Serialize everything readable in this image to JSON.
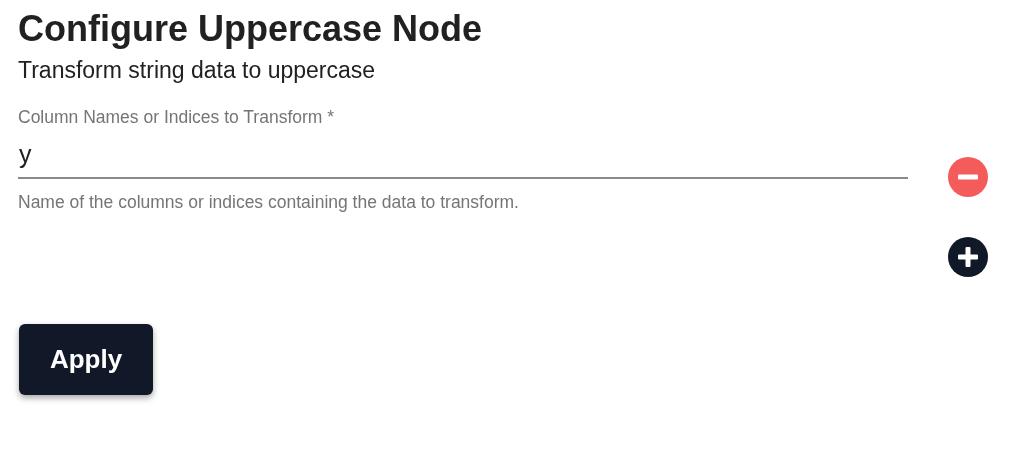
{
  "title": "Configure Uppercase Node",
  "subtitle": "Transform string data to uppercase",
  "fields": [
    {
      "label": "Column Names or Indices to Transform *",
      "value": "y",
      "helper": "Name of the columns or indices containing the data to transform."
    }
  ],
  "apply_button": "Apply"
}
